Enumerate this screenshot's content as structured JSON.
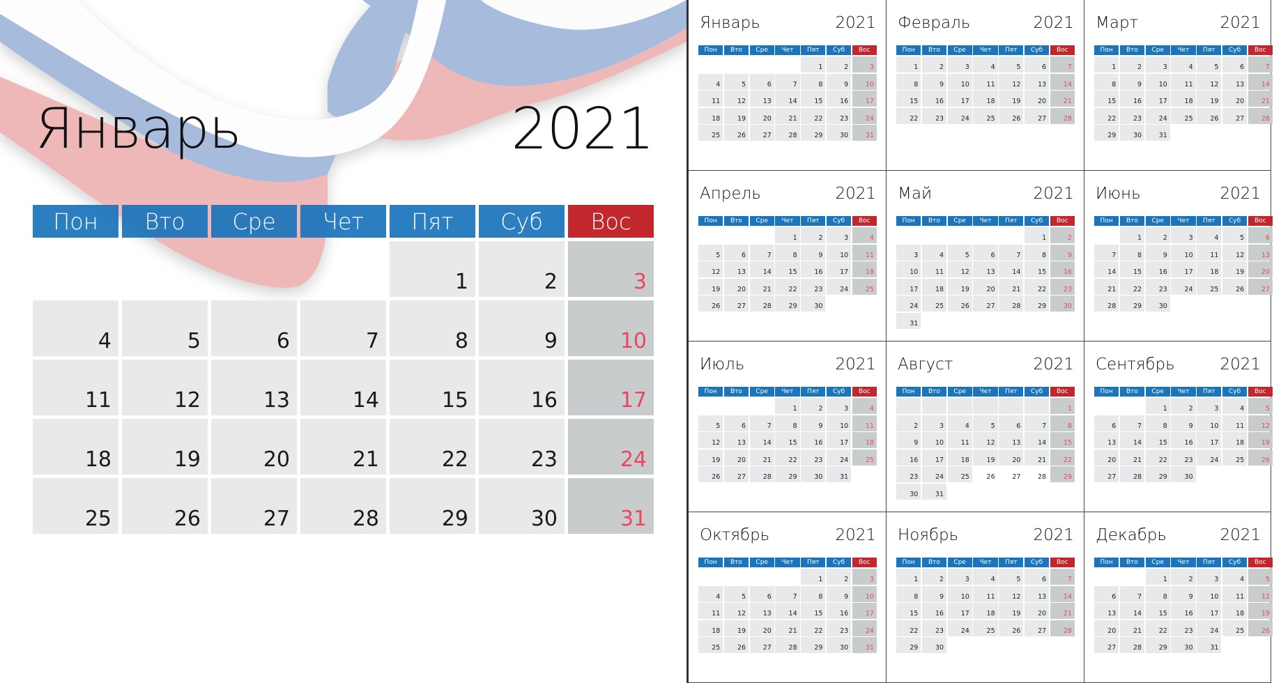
{
  "year": "2021",
  "weekdays": [
    "Пон",
    "Вто",
    "Сре",
    "Чет",
    "Пят",
    "Суб",
    "Вос"
  ],
  "colors": {
    "header_blue": "#1b75bc",
    "header_sunday": "#c1272d",
    "cell": "#e8e9ea",
    "cell_sunday": "#c9cccd",
    "sunday_text": "#e8475d",
    "ribbon_blue": "#a7bbdd",
    "ribbon_red": "#efb8b8"
  },
  "featured": {
    "month": "Январь",
    "year": "2021",
    "weeks": [
      [
        null,
        null,
        null,
        null,
        1,
        2,
        3
      ],
      [
        4,
        5,
        6,
        7,
        8,
        9,
        10
      ],
      [
        11,
        12,
        13,
        14,
        15,
        16,
        17
      ],
      [
        18,
        19,
        20,
        21,
        22,
        23,
        24
      ],
      [
        25,
        26,
        27,
        28,
        29,
        30,
        31
      ]
    ]
  },
  "months": [
    {
      "name": "Январь",
      "year": "2021",
      "weeks": [
        [
          null,
          null,
          null,
          null,
          1,
          2,
          3
        ],
        [
          4,
          5,
          6,
          7,
          8,
          9,
          10
        ],
        [
          11,
          12,
          13,
          14,
          15,
          16,
          17
        ],
        [
          18,
          19,
          20,
          21,
          22,
          23,
          24
        ],
        [
          25,
          26,
          27,
          28,
          29,
          30,
          31
        ]
      ]
    },
    {
      "name": "Февраль",
      "year": "2021",
      "weeks": [
        [
          1,
          2,
          3,
          4,
          5,
          6,
          7
        ],
        [
          8,
          9,
          10,
          11,
          12,
          13,
          14
        ],
        [
          15,
          16,
          17,
          18,
          19,
          20,
          21
        ],
        [
          22,
          23,
          24,
          25,
          26,
          27,
          28
        ]
      ]
    },
    {
      "name": "Март",
      "year": "2021",
      "weeks": [
        [
          1,
          2,
          3,
          4,
          5,
          6,
          7
        ],
        [
          8,
          9,
          10,
          11,
          12,
          13,
          14
        ],
        [
          15,
          16,
          17,
          18,
          19,
          20,
          21
        ],
        [
          22,
          23,
          24,
          25,
          26,
          27,
          28
        ],
        [
          29,
          30,
          31,
          null,
          null,
          null,
          null
        ]
      ]
    },
    {
      "name": "Апрель",
      "year": "2021",
      "weeks": [
        [
          null,
          null,
          null,
          1,
          2,
          3,
          4
        ],
        [
          5,
          6,
          7,
          8,
          9,
          10,
          11
        ],
        [
          12,
          13,
          14,
          15,
          16,
          17,
          18
        ],
        [
          19,
          20,
          21,
          22,
          23,
          24,
          25
        ],
        [
          26,
          27,
          28,
          29,
          30,
          null,
          null
        ]
      ]
    },
    {
      "name": "Май",
      "year": "2021",
      "weeks": [
        [
          null,
          null,
          null,
          null,
          null,
          1,
          2
        ],
        [
          3,
          4,
          5,
          6,
          7,
          8,
          9
        ],
        [
          10,
          11,
          12,
          13,
          14,
          15,
          16
        ],
        [
          17,
          18,
          19,
          20,
          21,
          22,
          23
        ],
        [
          24,
          25,
          26,
          27,
          28,
          29,
          30
        ],
        [
          31,
          null,
          null,
          null,
          null,
          null,
          null
        ]
      ]
    },
    {
      "name": "Июнь",
      "year": "2021",
      "weeks": [
        [
          null,
          1,
          2,
          3,
          4,
          5,
          6
        ],
        [
          7,
          8,
          9,
          10,
          11,
          12,
          13
        ],
        [
          14,
          15,
          16,
          17,
          18,
          19,
          20
        ],
        [
          21,
          22,
          23,
          24,
          25,
          26,
          27
        ],
        [
          28,
          29,
          30,
          null,
          null,
          null,
          null
        ]
      ]
    },
    {
      "name": "Июль",
      "year": "2021",
      "weeks": [
        [
          null,
          null,
          null,
          1,
          2,
          3,
          4
        ],
        [
          5,
          6,
          7,
          8,
          9,
          10,
          11
        ],
        [
          12,
          13,
          14,
          15,
          16,
          17,
          18
        ],
        [
          19,
          20,
          21,
          22,
          23,
          24,
          25
        ],
        [
          26,
          27,
          28,
          29,
          30,
          31,
          null
        ]
      ]
    },
    {
      "name": "Август",
      "year": "2021",
      "weeks": [
        [
          null,
          null,
          null,
          null,
          null,
          null,
          1
        ],
        [
          2,
          3,
          4,
          5,
          6,
          7,
          8
        ],
        [
          9,
          10,
          11,
          12,
          13,
          14,
          15
        ],
        [
          16,
          17,
          18,
          19,
          20,
          21,
          22
        ],
        [
          23,
          24,
          25,
          26,
          27,
          28,
          29
        ],
        [
          30,
          31,
          null,
          null,
          null,
          null,
          null
        ]
      ],
      "filled_override": {
        "0": [
          true,
          true,
          true,
          true,
          true,
          true,
          true
        ],
        "4": [
          true,
          true,
          true,
          false,
          false,
          false,
          true
        ]
      }
    },
    {
      "name": "Сентябрь",
      "year": "2021",
      "weeks": [
        [
          null,
          null,
          1,
          2,
          3,
          4,
          5
        ],
        [
          6,
          7,
          8,
          9,
          10,
          11,
          12
        ],
        [
          13,
          14,
          15,
          16,
          17,
          18,
          19
        ],
        [
          20,
          21,
          22,
          23,
          24,
          25,
          26
        ],
        [
          27,
          28,
          29,
          30,
          null,
          null,
          null
        ]
      ]
    },
    {
      "name": "Октябрь",
      "year": "2021",
      "weeks": [
        [
          null,
          null,
          null,
          null,
          1,
          2,
          3
        ],
        [
          4,
          5,
          6,
          7,
          8,
          9,
          10
        ],
        [
          11,
          12,
          13,
          14,
          15,
          16,
          17
        ],
        [
          18,
          19,
          20,
          21,
          22,
          23,
          24
        ],
        [
          25,
          26,
          27,
          28,
          29,
          30,
          31
        ]
      ]
    },
    {
      "name": "Ноябрь",
      "year": "2021",
      "weeks": [
        [
          1,
          2,
          3,
          4,
          5,
          6,
          7
        ],
        [
          8,
          9,
          10,
          11,
          12,
          13,
          14
        ],
        [
          15,
          16,
          17,
          18,
          19,
          20,
          21
        ],
        [
          22,
          23,
          24,
          25,
          26,
          27,
          28
        ],
        [
          29,
          30,
          null,
          null,
          null,
          null,
          null
        ]
      ]
    },
    {
      "name": "Декабрь",
      "year": "2021",
      "weeks": [
        [
          null,
          null,
          1,
          2,
          3,
          4,
          5
        ],
        [
          6,
          7,
          8,
          9,
          10,
          11,
          12
        ],
        [
          13,
          14,
          15,
          16,
          17,
          18,
          19
        ],
        [
          20,
          21,
          22,
          23,
          24,
          25,
          26
        ],
        [
          27,
          28,
          29,
          30,
          31,
          null,
          null
        ]
      ]
    }
  ]
}
